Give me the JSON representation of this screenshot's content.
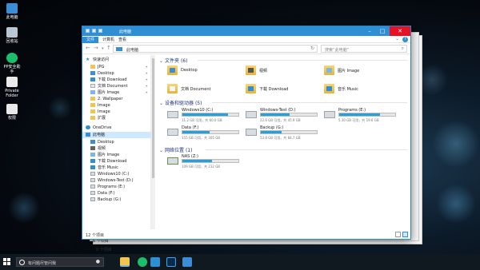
{
  "desktop": {
    "icons": [
      {
        "label": "此电脑"
      },
      {
        "label": "回收站"
      },
      {
        "label": "PP安全助手"
      },
      {
        "label": "Private Folder"
      },
      {
        "label": "权限"
      }
    ]
  },
  "window": {
    "title": "此电脑",
    "ribbon_tabs": [
      "文件",
      "计算机",
      "查看"
    ],
    "address_path": "此电脑",
    "search_placeholder": "搜索“此电脑”",
    "nav_icons": {
      "back": "back-arrow-icon",
      "forward": "forward-arrow-icon",
      "dropdown": "chevron-down-icon",
      "up": "up-arrow-icon"
    }
  },
  "nav_pane": {
    "items": [
      {
        "label": "快速访问",
        "icon": "star-icon",
        "level": 0
      },
      {
        "label": "JPG",
        "icon": "folder-icon",
        "level": 1,
        "pinned": true
      },
      {
        "label": "Desktop",
        "icon": "desktop-icon",
        "level": 1,
        "pinned": true
      },
      {
        "label": "下载 Download",
        "icon": "download-icon",
        "level": 1,
        "pinned": true
      },
      {
        "label": "文档 Document",
        "icon": "document-icon",
        "level": 1,
        "pinned": true
      },
      {
        "label": "图片 Image",
        "icon": "picture-icon",
        "level": 1,
        "pinned": true
      },
      {
        "label": "2. Wallpaper",
        "icon": "folder-icon",
        "level": 1
      },
      {
        "label": "Image",
        "icon": "folder-icon",
        "level": 1
      },
      {
        "label": "Image",
        "icon": "folder-icon",
        "level": 1
      },
      {
        "label": "扩展",
        "icon": "folder-icon",
        "level": 1
      },
      {
        "label": "OneDrive",
        "icon": "cloud-icon",
        "level": 0
      },
      {
        "label": "此电脑",
        "icon": "computer-icon",
        "level": 0,
        "selected": true
      },
      {
        "label": "Desktop",
        "icon": "desktop-icon",
        "level": 1
      },
      {
        "label": "视频",
        "icon": "video-icon",
        "level": 1
      },
      {
        "label": "图片 Image",
        "icon": "picture-icon",
        "level": 1
      },
      {
        "label": "下载 Download",
        "icon": "download-icon",
        "level": 1
      },
      {
        "label": "音乐 Music",
        "icon": "music-icon",
        "level": 1
      },
      {
        "label": "Windows10 (C:)",
        "icon": "drive-icon",
        "level": 1
      },
      {
        "label": "Windows-Test (D:)",
        "icon": "drive-icon",
        "level": 1
      },
      {
        "label": "Programs (E:)",
        "icon": "drive-icon",
        "level": 1
      },
      {
        "label": "Data (F:)",
        "icon": "drive-icon",
        "level": 1
      },
      {
        "label": "Backup (G:)",
        "icon": "drive-icon",
        "level": 1
      }
    ]
  },
  "content": {
    "folders_header": "文件夹 (6)",
    "folders": [
      {
        "label": "Desktop",
        "icon": "desktop-icon"
      },
      {
        "label": "视频",
        "icon": "video-icon"
      },
      {
        "label": "图片 Image",
        "icon": "picture-icon"
      },
      {
        "label": "文档 Document",
        "icon": "document-icon"
      },
      {
        "label": "下载 Download",
        "icon": "download-icon"
      },
      {
        "label": "音乐 Music",
        "icon": "music-icon"
      }
    ],
    "devices_header": "设备和驱动器 (5)",
    "drives": [
      {
        "name": "Windows10 (C:)",
        "free_text": "11.2 GB 可用，共 60.0 GB",
        "used": 0.81
      },
      {
        "name": "Windows-Test (D:)",
        "free_text": "22.6 GB 可用，共 45.9 GB",
        "used": 0.51
      },
      {
        "name": "Programs (E:)",
        "free_text": "5.30 GB 可用，共 19.6 GB",
        "used": 0.73
      },
      {
        "name": "Data (F:)",
        "free_text": "155 GB 可用，共 305 GB",
        "used": 0.49
      },
      {
        "name": "Backup (G:)",
        "free_text": "53.8 GB 可用，共 84.7 GB",
        "used": 0.37
      }
    ],
    "network_header": "网络位置 (1)",
    "network": [
      {
        "name": "NAS (Z:)",
        "free_text": "109 GB 可用，共 232 GB",
        "used": 0.53
      }
    ]
  },
  "statusbar": {
    "text": "12 个项目"
  },
  "ghost_status": {
    "text1": "6 个项目",
    "text2": "0 个项目"
  },
  "taskbar": {
    "search_placeholder": "有问题尽管问我",
    "apps": [
      "file-explorer-icon",
      "edge-icon",
      "pp-assistant-icon",
      "photoshop-icon",
      "app-icon"
    ]
  },
  "colors": {
    "accent": "#2f8fd4",
    "close": "#e81123",
    "drive_fill": "#26a0da",
    "folder": "#f2c450"
  }
}
